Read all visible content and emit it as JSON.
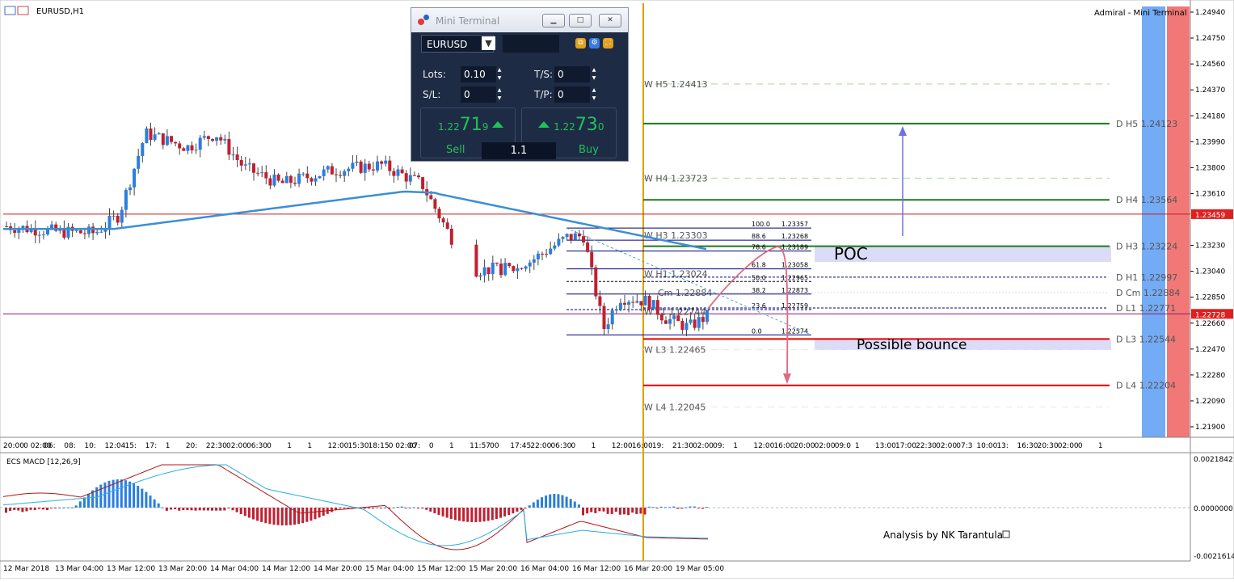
{
  "window_title": "EURUSD,H1",
  "broker_label": "Admiral - Mini Terminal",
  "price_axis": {
    "labels": [
      "1.24940",
      "1.24750",
      "1.24560",
      "1.24370",
      "1.24180",
      "1.23990",
      "1.23800",
      "1.23610",
      "1.23230",
      "1.23040",
      "1.22850",
      "1.22660",
      "1.22470",
      "1.22280",
      "1.22090",
      "1.21900"
    ],
    "current_price": "1.22728",
    "red_line_price": "1.23459",
    "ylim": [
      1.218,
      1.2499
    ]
  },
  "time_axis_top": [
    "20:00",
    "0 02:00",
    "06:",
    "08:",
    "10:",
    "12:04",
    "15:",
    "17:",
    "1",
    "20:",
    "22:30",
    "02:00",
    "06:30",
    "0",
    "1",
    "1",
    "12:00",
    "15:30",
    "18:15",
    "0 02:00",
    "07:",
    "0",
    "1",
    "11:57",
    "00",
    "17:45",
    "22:00",
    "06:30",
    "0",
    "1",
    "12:00",
    "16:00",
    "19:",
    "21:30",
    "02:00",
    "09:",
    "1",
    "12:00",
    "16:00",
    "20:00",
    "02:00",
    "09:0",
    "1",
    "13:00",
    "17:00",
    "22:30",
    "02:00",
    "07:3",
    "10:00",
    "13:",
    "16:30",
    "20:30",
    "02:00",
    "0",
    "1"
  ],
  "time_axis_bottom": [
    "12 Mar 2018",
    "13 Mar 04:00",
    "13 Mar 12:00",
    "13 Mar 20:00",
    "14 Mar 04:00",
    "14 Mar 12:00",
    "14 Mar 20:00",
    "15 Mar 04:00",
    "15 Mar 12:00",
    "15 Mar 20:00",
    "16 Mar 04:00",
    "16 Mar 12:00",
    "16 Mar 20:00",
    "19 Mar 05:00"
  ],
  "weekly_levels": [
    {
      "label": "W  H5 1.24413",
      "price": 1.24413
    },
    {
      "label": "W  H4 1.23723",
      "price": 1.23723
    },
    {
      "label": "W  H3 1.23303",
      "price": 1.23303
    },
    {
      "label": "W  H1 1.23024",
      "price": 1.23024
    },
    {
      "label": "Cm 1.22884",
      "price": 1.22884
    },
    {
      "label": "W  L1 1.22744",
      "price": 1.22744
    },
    {
      "label": "W  L3 1.22465",
      "price": 1.22465
    },
    {
      "label": "W  L4 1.22045",
      "price": 1.22045
    }
  ],
  "daily_levels": [
    {
      "label": "D  H5 1.24123",
      "price": 1.24123,
      "color": "#1a7a1a"
    },
    {
      "label": "D  H4 1.23564",
      "price": 1.23564,
      "color": "#1a7a1a"
    },
    {
      "label": "D  H3 1.23224",
      "price": 1.23224,
      "color": "#1a7a1a"
    },
    {
      "label": "D  H1 1.22997",
      "price": 1.22997,
      "color": "#000080"
    },
    {
      "label": "D  Cm 1.22884",
      "price": 1.22884,
      "color": "#999999"
    },
    {
      "label": "D  L1 1.22771",
      "price": 1.22771,
      "color": "#000080"
    },
    {
      "label": "D  L3 1.22544",
      "price": 1.22544,
      "color": "#e00000"
    },
    {
      "label": "D  L4 1.22204",
      "price": 1.22204,
      "color": "#e00000"
    }
  ],
  "fibonacci": [
    {
      "level": "100.0",
      "price": "1.23357"
    },
    {
      "level": "88.6",
      "price": "1.23268"
    },
    {
      "level": "78.6",
      "price": "1.23189"
    },
    {
      "level": "61.8",
      "price": "1.23058"
    },
    {
      "level": "50.0",
      "price": "1.22965"
    },
    {
      "level": "38.2",
      "price": "1.22873"
    },
    {
      "level": "23.6",
      "price": "1.22759"
    },
    {
      "level": "0.0",
      "price": "1.22574"
    }
  ],
  "annotations": {
    "poc": "POC",
    "bounce": "Possible bounce",
    "credit": "Analysis by NK Tarantula"
  },
  "macd": {
    "title": "ECS MACD [12,26,9]",
    "axis_labels": [
      "0.0021842",
      "0.0000000",
      "-0.0021614"
    ]
  },
  "mini_terminal": {
    "title": "Mini Terminal",
    "symbol": "EURUSD",
    "lots_label": "Lots:",
    "lots": "0.10",
    "ts_label": "T/S:",
    "ts": "0",
    "sl_label": "S/L:",
    "sl": "0",
    "tp_label": "T/P:",
    "tp": "0",
    "sell_small": "1.22",
    "sell_big": "71",
    "sell_sup": "9",
    "buy_small": "1.22",
    "buy_big": "73",
    "buy_sup": "0",
    "sell_label": "Sell",
    "buy_label": "Buy",
    "volume": "1.1"
  },
  "chart_data": {
    "type": "candlestick",
    "symbol": "EURUSD",
    "timeframe": "H1",
    "ylim": [
      1.218,
      1.2499
    ],
    "approx_close_path": [
      {
        "x": "12 Mar 20:00",
        "y": 1.2337
      },
      {
        "x": "13 Mar 04:00",
        "y": 1.2333
      },
      {
        "x": "13 Mar 12:00",
        "y": 1.2345
      },
      {
        "x": "13 Mar 16:00",
        "y": 1.2405
      },
      {
        "x": "13 Mar 20:00",
        "y": 1.2405
      },
      {
        "x": "14 Mar 04:00",
        "y": 1.239
      },
      {
        "x": "14 Mar 12:00",
        "y": 1.2368
      },
      {
        "x": "14 Mar 20:00",
        "y": 1.2378
      },
      {
        "x": "15 Mar 04:00",
        "y": 1.2382
      },
      {
        "x": "15 Mar 08:00",
        "y": 1.2368
      },
      {
        "x": "15 Mar 12:00",
        "y": 1.2337
      },
      {
        "x": "15 Mar 16:00",
        "y": 1.2305
      },
      {
        "x": "15 Mar 20:00",
        "y": 1.2305
      },
      {
        "x": "16 Mar 04:00",
        "y": 1.2319
      },
      {
        "x": "16 Mar 08:00",
        "y": 1.233
      },
      {
        "x": "16 Mar 12:00",
        "y": 1.2262
      },
      {
        "x": "16 Mar 16:00",
        "y": 1.2285
      },
      {
        "x": "16 Mar 20:00",
        "y": 1.2279
      },
      {
        "x": "19 Mar 05:00",
        "y": 1.2273
      }
    ]
  }
}
